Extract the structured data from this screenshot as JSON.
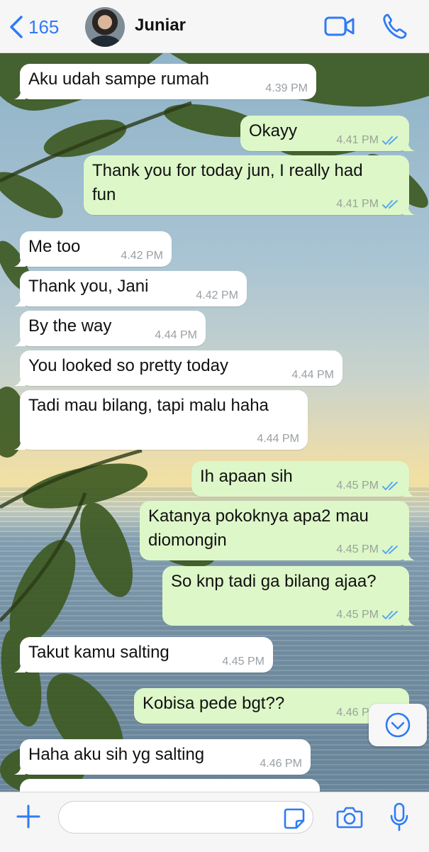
{
  "header": {
    "back_count": "165",
    "contact_name": "Juniar"
  },
  "colors": {
    "accent": "#2f7bf5",
    "incoming_bubble": "#ffffff",
    "outgoing_bubble": "#ddf7c8",
    "read_ticks": "#5aa7f0"
  },
  "messages": [
    {
      "dir": "in",
      "text": "Aku udah sampe rumah",
      "time": "4.39 PM"
    },
    {
      "dir": "out",
      "text": "Okayy",
      "time": "4.41 PM",
      "status": "read"
    },
    {
      "dir": "out",
      "text": "Thank you for today jun, I really had\nfun",
      "time": "4.41 PM",
      "status": "read"
    },
    {
      "dir": "in",
      "text": "Me too",
      "time": "4.42 PM"
    },
    {
      "dir": "in",
      "text": "Thank you, Jani",
      "time": "4.42 PM"
    },
    {
      "dir": "in",
      "text": "By the way",
      "time": "4.44 PM"
    },
    {
      "dir": "in",
      "text": "You looked so pretty today",
      "time": "4.44 PM"
    },
    {
      "dir": "in",
      "text": "Tadi mau bilang, tapi malu haha",
      "time": "4.44 PM"
    },
    {
      "dir": "out",
      "text": "Ih apaan sih",
      "time": "4.45 PM",
      "status": "read"
    },
    {
      "dir": "out",
      "text": "Katanya pokoknya apa2 mau\ndiomongin",
      "time": "4.45 PM",
      "status": "read"
    },
    {
      "dir": "out",
      "text": "So knp tadi ga bilang ajaa?",
      "time": "4.45 PM",
      "status": "read"
    },
    {
      "dir": "in",
      "text": "Takut kamu salting",
      "time": "4.45 PM"
    },
    {
      "dir": "out",
      "text": "Kobisa pede bgt??",
      "time": "4.46 PM",
      "status": "read"
    },
    {
      "dir": "in",
      "text": "Haha aku sih yg salting",
      "time": "4.46 PM"
    },
    {
      "dir": "in",
      "text": "",
      "time": ""
    }
  ],
  "input": {
    "message_value": "",
    "message_placeholder": ""
  },
  "icons": [
    "chevron-left-icon",
    "video-camera-icon",
    "phone-icon",
    "chevron-down-icon",
    "plus-icon",
    "sticker-icon",
    "camera-icon",
    "microphone-icon",
    "double-check-icon"
  ]
}
